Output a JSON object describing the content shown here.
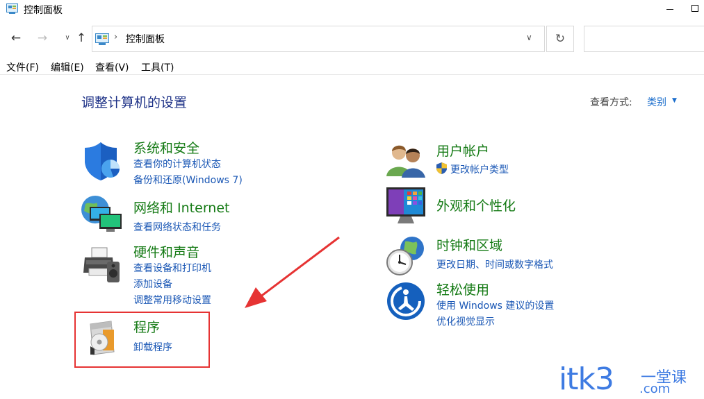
{
  "window": {
    "title": "控制面板",
    "icon": "control-panel-icon"
  },
  "address": {
    "path": "控制面板",
    "back_icon": "←",
    "forward_icon": "→",
    "recent_icon": "∨",
    "up_icon": "↑",
    "separator": "›",
    "dropdown_icon": "∨",
    "refresh_icon": "↻"
  },
  "menu": {
    "file": "文件(F)",
    "edit": "编辑(E)",
    "view": "查看(V)",
    "tools": "工具(T)"
  },
  "main": {
    "title": "调整计算机的设置",
    "view_by_label": "查看方式:",
    "view_by_value": "类别",
    "view_by_caret": "▼"
  },
  "categories_left": [
    {
      "title": "系统和安全",
      "icon": "shield-icon",
      "links": [
        "查看你的计算机状态",
        "备份和还原(Windows 7)"
      ]
    },
    {
      "title": "网络和 Internet",
      "icon": "network-globe-icon",
      "links": [
        "查看网络状态和任务"
      ]
    },
    {
      "title": "硬件和声音",
      "icon": "printer-speaker-icon",
      "links": [
        "查看设备和打印机",
        "添加设备",
        "调整常用移动设置"
      ]
    },
    {
      "title": "程序",
      "icon": "programs-disc-icon",
      "links": [
        "卸载程序"
      ]
    }
  ],
  "categories_right": [
    {
      "title": "用户帐户",
      "icon": "users-icon",
      "links": [
        "更改帐户类型"
      ],
      "link_icon": "uac-shield-icon"
    },
    {
      "title": "外观和个性化",
      "icon": "monitor-tiles-icon",
      "links": []
    },
    {
      "title": "时钟和区域",
      "icon": "clock-globe-icon",
      "links": [
        "更改日期、时间或数字格式"
      ]
    },
    {
      "title": "轻松使用",
      "icon": "ease-of-access-icon",
      "links": [
        "使用 Windows 建议的设置",
        "优化视觉显示"
      ]
    }
  ],
  "annotation": {
    "highlight_color": "#e63333",
    "arrow_color": "#e63333"
  },
  "watermark": {
    "main": "itk3",
    "cn": "一堂课",
    "suffix": ".com"
  },
  "colors": {
    "category_title": "#147a14",
    "link": "#1a57b5",
    "page_title": "#1e3287",
    "accent": "#3e7be2"
  }
}
